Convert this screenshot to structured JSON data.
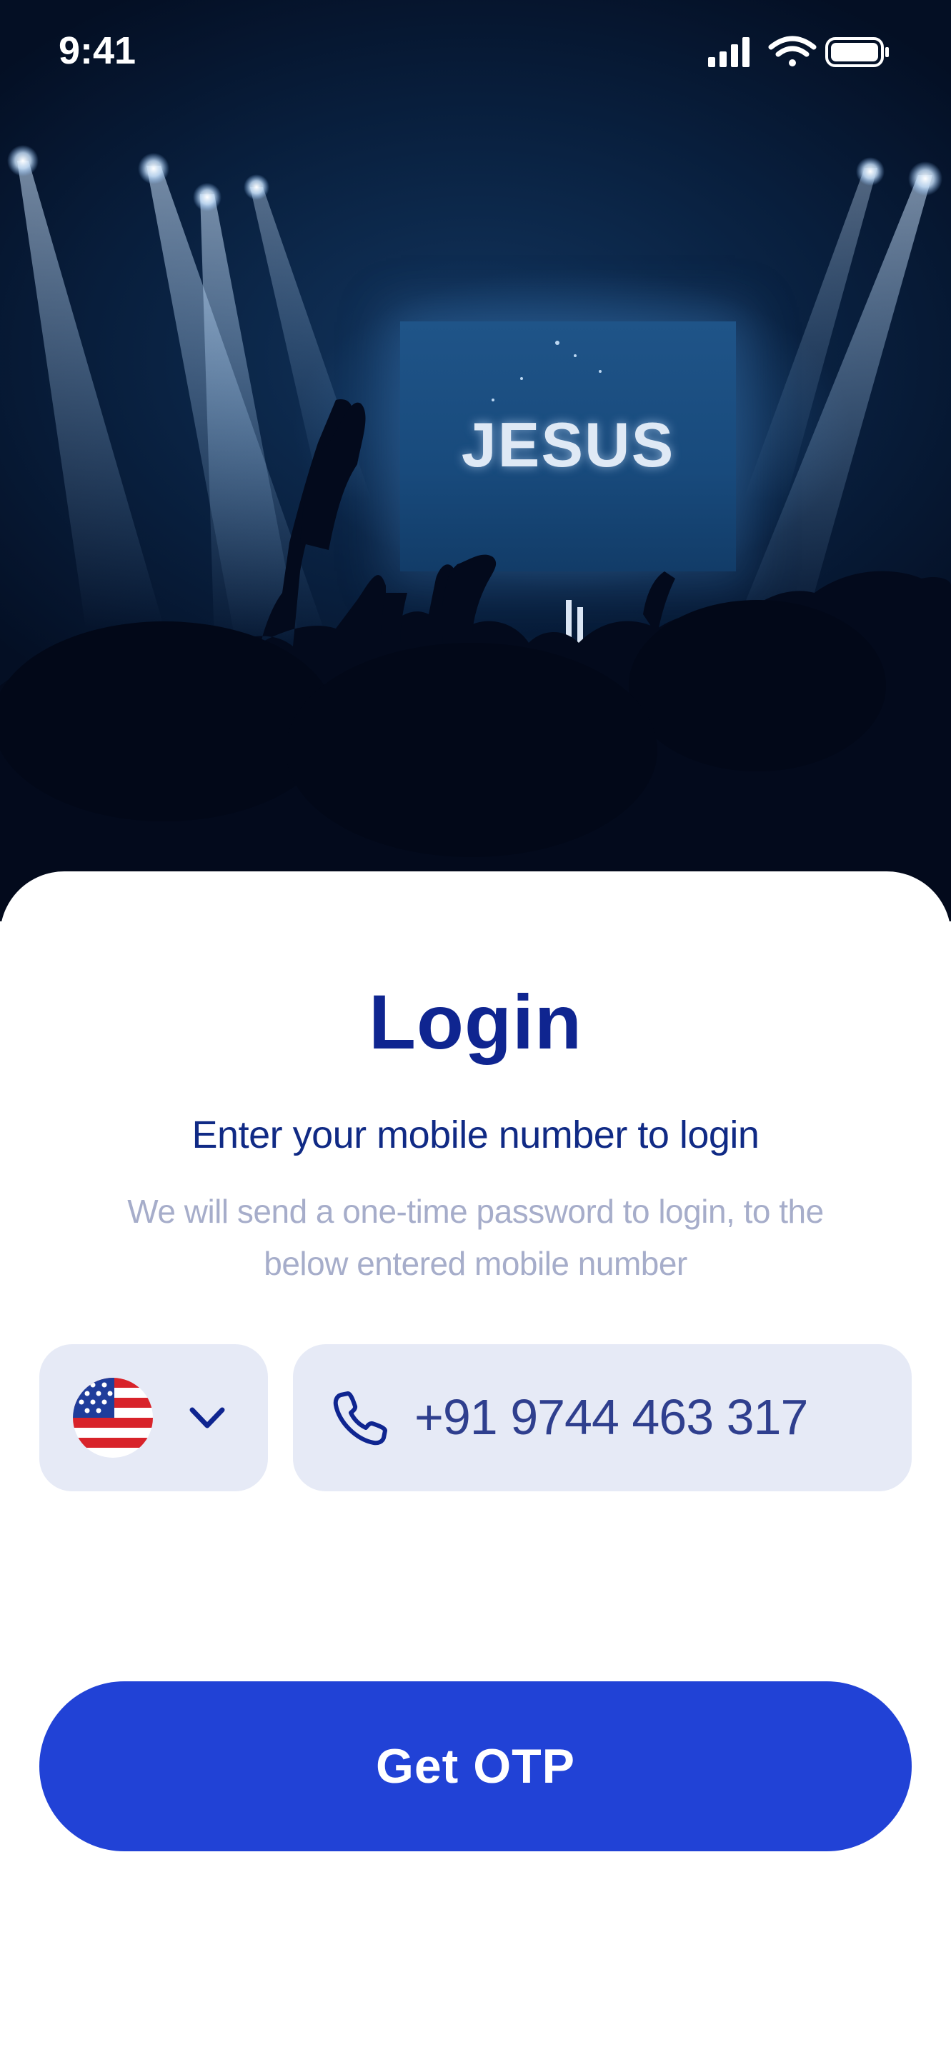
{
  "status_bar": {
    "time": "9:41",
    "icons": [
      "signal-icon",
      "wifi-icon",
      "battery-icon"
    ]
  },
  "hero": {
    "screen_text": "JESUS"
  },
  "login": {
    "title": "Login",
    "subtitle": "Enter your mobile number to login",
    "description": "We will send a one-time password to login, to the below entered mobile number"
  },
  "country_select": {
    "flag": "us-flag-icon",
    "dropdown_icon": "chevron-down-icon"
  },
  "phone_field": {
    "icon": "phone-icon",
    "value": "+91 9744 463 317"
  },
  "otp_button": {
    "label": "Get OTP"
  },
  "colors": {
    "primary": "#2142D6",
    "title": "#0F2590",
    "input_bg": "#E6EAF6",
    "muted_text": "#A6ADCA"
  }
}
